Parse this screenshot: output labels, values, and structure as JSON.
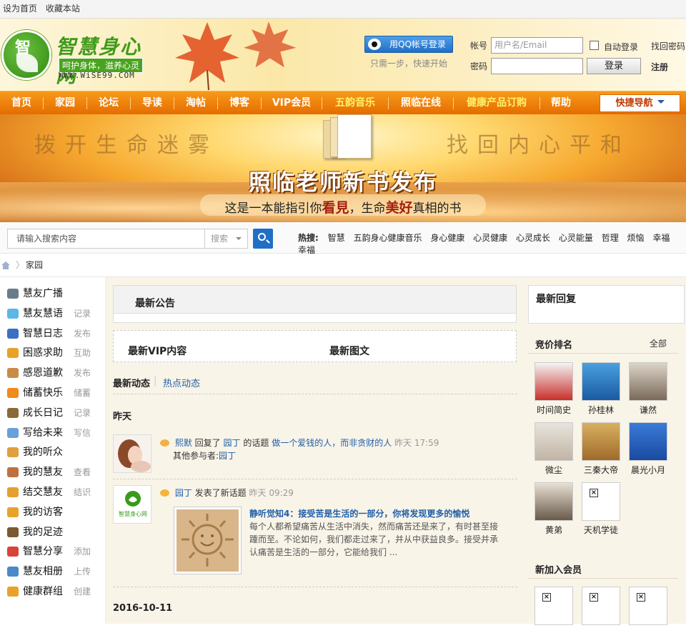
{
  "topbar": {
    "set_home": "设为首页",
    "bookmark": "收藏本站"
  },
  "logo": {
    "name": "智慧身心网",
    "slogan": "呵护身体，滋养心灵",
    "url": "WWW.WiSE99.COM",
    "badge": "智"
  },
  "login": {
    "qq_button": "用QQ帐号登录",
    "qq_hint": "只需一步，快速开始",
    "account_label": "帐号",
    "account_placeholder": "用户名/Email",
    "password_label": "密码",
    "auto_login": "自动登录",
    "find_password": "找回密码",
    "login_button": "登录",
    "register": "注册"
  },
  "nav": {
    "items": [
      "首页",
      "家园",
      "论坛",
      "导读",
      "淘帖",
      "博客",
      "VIP会员",
      "五韵音乐",
      "照临在线",
      "健康产品订购",
      "帮助"
    ],
    "quick_nav": "快捷导航"
  },
  "banner": {
    "left_text": "拨开生命迷雾",
    "right_text": "找回内心平和",
    "title": "照临老师新书发布",
    "sub_1": "这是一本能指引你",
    "sub_em1": "看見",
    "sub_2": "，生命",
    "sub_em2": "美好",
    "sub_3": "真相的书"
  },
  "search": {
    "placeholder": "请输入搜索内容",
    "select": "搜索",
    "hot_label": "热搜:",
    "hot_terms": [
      "智慧",
      "五韵身心健康音乐",
      "身心健康",
      "心灵健康",
      "心灵成长",
      "心灵能量",
      "哲理",
      "烦恼",
      "幸福",
      "幸福"
    ]
  },
  "breadcrumb": {
    "current": "家园"
  },
  "sidebar": {
    "items": [
      {
        "label": "慧友广播",
        "action": "",
        "color": "#6a7c8c"
      },
      {
        "label": "慧友慧语",
        "action": "记录",
        "color": "#5bb7e6"
      },
      {
        "label": "智慧日志",
        "action": "发布",
        "color": "#3b6fc2"
      },
      {
        "label": "困惑求助",
        "action": "互助",
        "color": "#e8a22a"
      },
      {
        "label": "感恩道歉",
        "action": "发布",
        "color": "#c98b45"
      },
      {
        "label": "储蓄快乐",
        "action": "储蓄",
        "color": "#f08a1c"
      },
      {
        "label": "成长日记",
        "action": "记录",
        "color": "#8a6a3a"
      },
      {
        "label": "写给未来",
        "action": "写信",
        "color": "#6aa0d8"
      },
      {
        "label": "我的听众",
        "action": "",
        "color": "#e0a040"
      },
      {
        "label": "我的慧友",
        "action": "查看",
        "color": "#c07040"
      },
      {
        "label": "结交慧友",
        "action": "结识",
        "color": "#e6a030"
      },
      {
        "label": "我的访客",
        "action": "",
        "color": "#e8a22a"
      },
      {
        "label": "我的足迹",
        "action": "",
        "color": "#7a5a30"
      },
      {
        "label": "智慧分享",
        "action": "添加",
        "color": "#d8443a"
      },
      {
        "label": "慧友相册",
        "action": "上传",
        "color": "#4a8ac8"
      },
      {
        "label": "健康群组",
        "action": "创建",
        "color": "#e8a22a"
      }
    ]
  },
  "center": {
    "announcement_title": "最新公告",
    "vip_title": "最新VIP内容",
    "photo_title": "最新图文",
    "feed_tab_active": "最新动态",
    "feed_tab_sep": "|",
    "feed_tab_other": "热点动态",
    "day_1": "昨天",
    "feed": [
      {
        "user": "熙默",
        "verb": "回复了",
        "target_user": "园丁",
        "mid": "的话题",
        "topic": "做一个爱钱的人，而非贪财的人",
        "time": "昨天 17:59",
        "extra_label": "其他参与者:",
        "extra_user": "园丁"
      },
      {
        "user": "园丁",
        "verb": "发表了新话题",
        "time": "昨天 09:29",
        "article_title": "静听觉知4：接受苦是生活的一部分，你将发现更多的愉悦",
        "article_excerpt": "每个人都希望痛苦从生活中消失，然而痛苦还是来了，有时甚至接踵而至。不论如何，我们都走过来了，并从中获益良多。接受并承认痛苦是生活的一部分，它能给我们 ...",
        "avatar_text": "智慧身心网"
      }
    ],
    "day_2": "2016-10-11"
  },
  "right": {
    "latest_reply_title": "最新回复",
    "rank_title": "竞价排名",
    "rank_all": "全部",
    "rank_users": [
      "时间简史",
      "孙桂林",
      "谦然",
      "微尘",
      "三秦大帝",
      "晨光小月",
      "黄弟",
      "天机学徒"
    ],
    "new_members_title": "新加入会员"
  }
}
